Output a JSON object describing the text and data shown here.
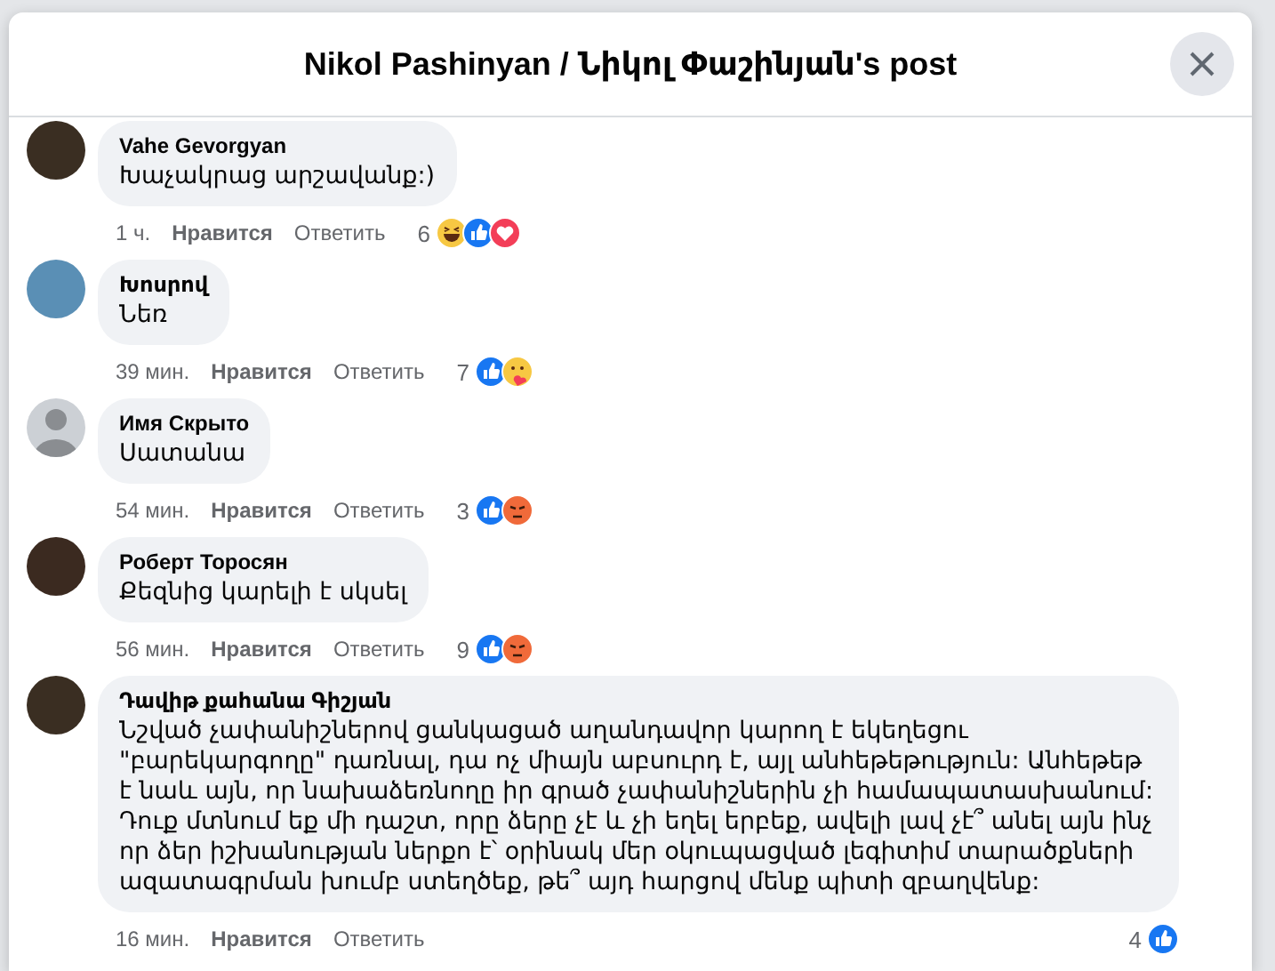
{
  "dialog": {
    "title": "Nikol Pashinyan / Նիկոլ Փաշինյան's post"
  },
  "comments": [
    {
      "avatar": {
        "kind": "photo"
      },
      "author": "Vahe Gevorgyan",
      "text": "Խաչակրաց արշավանք:)",
      "time": "1 ч.",
      "like": "Нравится",
      "reply": "Ответить",
      "reaction_count": "6",
      "reactions": [
        {
          "kind": "haha"
        },
        {
          "kind": "like"
        },
        {
          "kind": "love"
        }
      ]
    },
    {
      "avatar": {
        "kind": "photo"
      },
      "author": "Խոսրով",
      "text": "Նեռ",
      "time": "39 мин.",
      "like": "Нравится",
      "reply": "Ответить",
      "reaction_count": "7",
      "reactions": [
        {
          "kind": "like"
        },
        {
          "kind": "care"
        }
      ]
    },
    {
      "avatar": {
        "kind": "silhouette"
      },
      "author": "Имя Скрыто",
      "text": "Սատանա",
      "time": "54 мин.",
      "like": "Нравится",
      "reply": "Ответить",
      "reaction_count": "3",
      "reactions": [
        {
          "kind": "like"
        },
        {
          "kind": "angry"
        }
      ]
    },
    {
      "avatar": {
        "kind": "photo"
      },
      "author": "Роберт Торосян",
      "text": "Քեզնից կարելի է սկսել",
      "time": "56 мин.",
      "like": "Нравится",
      "reply": "Ответить",
      "reaction_count": "9",
      "reactions": [
        {
          "kind": "like"
        },
        {
          "kind": "angry"
        }
      ]
    },
    {
      "avatar": {
        "kind": "photo"
      },
      "author": "Դավիթ քահանա Գիշյան",
      "text": "Նշված չափանիշներով ցանկացած աղանդավոր կարող է եկեղեցու \"բարեկարգողը\" դառնալ, դա ոչ միայն աբսուրդ է, այլ անհեթեթություն: Անհեթեթ է նաև այն, որ նախաձեռնողը իր գրած չափանիշներին չի համապատասխանում: Դուք մտնում եք մի դաշտ, որը ձերը չէ և չի եղել երբեք, ավելի լավ չէ՞ անել այն ինչ որ ձեր իշխանության ներքո է՝ օրինակ մեր օկուպացված լեգիտիմ տարածքների ազատագրման խումբ ստեղծեք, թե՞ այդ հարցով մենք պիտի զբաղվենք:",
      "time": "16 мин.",
      "like": "Нравится",
      "reply": "Ответить",
      "reaction_count": "4",
      "reactions": [
        {
          "kind": "like"
        }
      ]
    }
  ]
}
